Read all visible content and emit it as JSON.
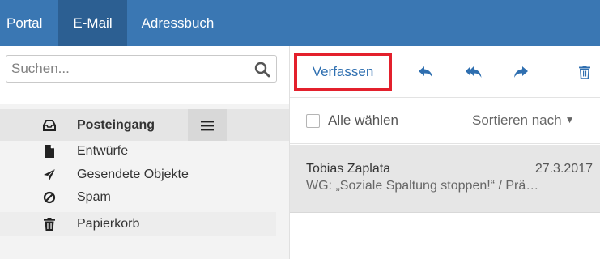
{
  "nav": {
    "tabs": [
      {
        "label": "Portal"
      },
      {
        "label": "E-Mail"
      },
      {
        "label": "Adressbuch"
      }
    ],
    "active_tab": "E-Mail"
  },
  "search": {
    "placeholder": "Suchen...",
    "icon": "search-icon"
  },
  "folders": [
    {
      "label": "Posteingang",
      "icon": "inbox-icon",
      "selected": true
    },
    {
      "label": "Entwürfe",
      "icon": "draft-icon"
    },
    {
      "label": "Gesendete Objekte",
      "icon": "send-icon"
    },
    {
      "label": "Spam",
      "icon": "spam-icon"
    },
    {
      "label": "Papierkorb",
      "icon": "trash-icon"
    }
  ],
  "toolbar": {
    "compose_label": "Verfassen",
    "icons": [
      "reply-icon",
      "reply-all-icon",
      "forward-icon",
      "delete-icon"
    ]
  },
  "list": {
    "select_all_label": "Alle wählen",
    "sort_label": "Sortieren nach"
  },
  "messages": [
    {
      "from": "Tobias Zaplata",
      "date": "27.3.2017",
      "subject": "WG: „Soziale Spaltung stoppen!“ / Prä…"
    }
  ],
  "colors": {
    "nav_bg": "#3a77b3",
    "nav_active": "#2c5f92",
    "accent": "#2f6fb0",
    "highlight_border": "#e3202c"
  }
}
